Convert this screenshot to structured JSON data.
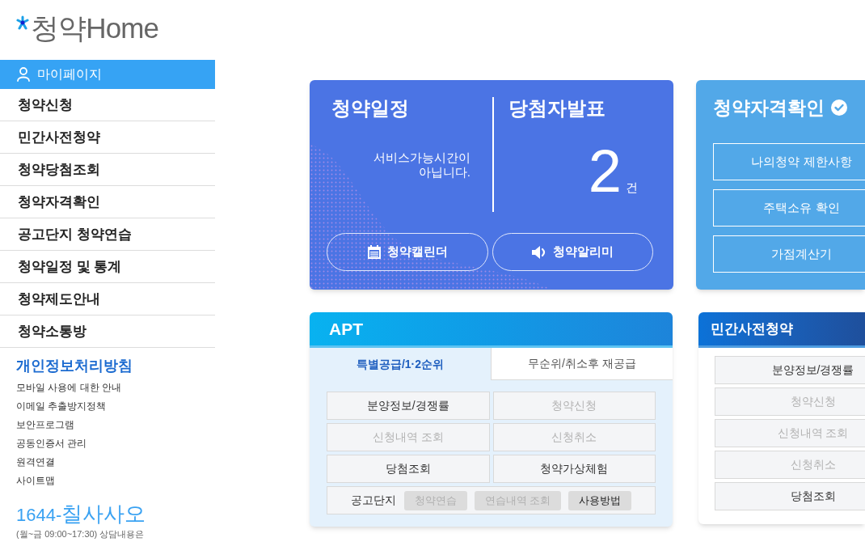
{
  "logo": {
    "text": "청약Home"
  },
  "sidebar": {
    "mypage": "마이페이지",
    "menu": [
      "청약신청",
      "민간사전청약",
      "청약당첨조회",
      "청약자격확인",
      "공고단지 청약연습",
      "청약일정 및 통계",
      "청약제도안내",
      "청약소통방"
    ],
    "policy_title": "개인정보처리방침",
    "links": [
      "모바일 사용에 대한 안내",
      "이메일 추출방지정책",
      "보안프로그램",
      "공동인증서 관리",
      "원격연결",
      "사이트맵"
    ],
    "phone": {
      "digits": "1644-",
      "letters": "칠사사오"
    },
    "hours_note": "(월~금 09:00~17:30) 상담내용은"
  },
  "schedule_panel": {
    "schedule": {
      "title": "청약일정",
      "message_lines": [
        "서비스가능시간이",
        "아닙니다."
      ]
    },
    "winners": {
      "title": "당첨자발표",
      "count": "2",
      "unit": "건"
    },
    "calendar_button": "청약캘린더",
    "alert_button": "청약알리미"
  },
  "eligibility_panel": {
    "title": "청약자격확인",
    "buttons": [
      "나의청약 제한사항",
      "주택소유 확인",
      "가점계산기"
    ]
  },
  "apt_panel": {
    "title": "APT",
    "tabs": [
      {
        "label": "특별공급/1·2순위",
        "selected": true
      },
      {
        "label": "무순위/취소후 재공급",
        "selected": false
      }
    ],
    "buttons": [
      {
        "label": "분양정보/경쟁률",
        "disabled": false
      },
      {
        "label": "청약신청",
        "disabled": true
      },
      {
        "label": "신청내역 조회",
        "disabled": true
      },
      {
        "label": "신청취소",
        "disabled": true
      },
      {
        "label": "당첨조회",
        "disabled": false
      },
      {
        "label": "청약가상체험",
        "disabled": false
      }
    ],
    "practice": {
      "label": "공고단지",
      "buttons": [
        {
          "label": "청약연습",
          "disabled": true
        },
        {
          "label": "연습내역 조회",
          "disabled": true
        },
        {
          "label": "사용방법",
          "disabled": false
        }
      ]
    }
  },
  "presale_panel": {
    "title": "민간사전청약",
    "buttons": [
      {
        "label": "분양정보/경쟁률",
        "disabled": false
      },
      {
        "label": "청약신청",
        "disabled": true
      },
      {
        "label": "신청내역 조회",
        "disabled": true
      },
      {
        "label": "신청취소",
        "disabled": true
      },
      {
        "label": "당첨조회",
        "disabled": false
      }
    ]
  }
}
